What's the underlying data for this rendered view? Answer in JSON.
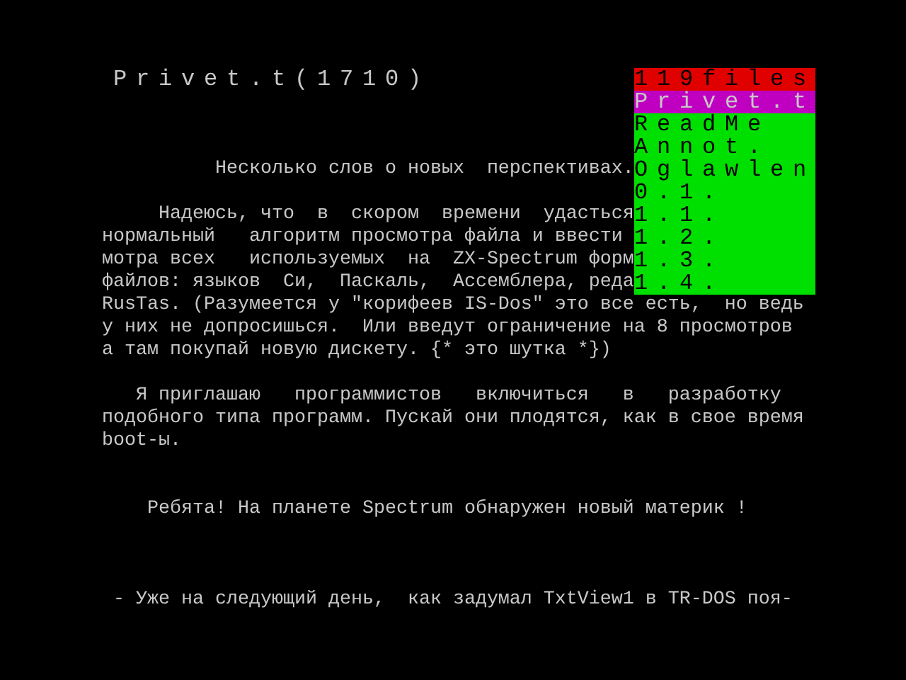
{
  "title": "Privet.t(1710)",
  "paragraphs": [
    [
      "          Несколько слов о новых  перспективах."
    ],
    [
      "     Надеюсь, что  в  скором  времени  удасться",
      "нормальный   алгоритм просмотра файла и ввести",
      "мотра всех   используемых  на  ZX-Spectrum форм",
      "файлов: языков  Си,  Паскаль,  Ассемблера, реда",
      "RusTas. (Разумеется у \"корифеев IS-Dos\" это все есть,  но ведь",
      "у них не допросишься.  Или введут ограничение на 8 просмотров",
      "а там покупай новую дискету. {* это шутка *})"
    ],
    [
      "   Я приглашаю   программистов   включиться   в   разработку",
      "подобного типа программ. Пускай они плодятся, как в свое время",
      "boot-ы."
    ],
    [
      "    Ребята! На планете Spectrum обнаружен новый материк !"
    ],
    [
      " - Уже на следующий день,  как задумал TxtView1 в TR-DOS поя-"
    ]
  ],
  "file_menu": {
    "count": "119files",
    "items": [
      {
        "label": "Privet.t",
        "selected": true
      },
      {
        "label": "ReadMe",
        "selected": false
      },
      {
        "label": "Annot.",
        "selected": false
      },
      {
        "label": "Oglawlen",
        "selected": false
      },
      {
        "label": "0.1.",
        "selected": false
      },
      {
        "label": "1.1.",
        "selected": false
      },
      {
        "label": "1.2.",
        "selected": false
      },
      {
        "label": "1.3.",
        "selected": false
      },
      {
        "label": "1.4.",
        "selected": false
      }
    ]
  }
}
